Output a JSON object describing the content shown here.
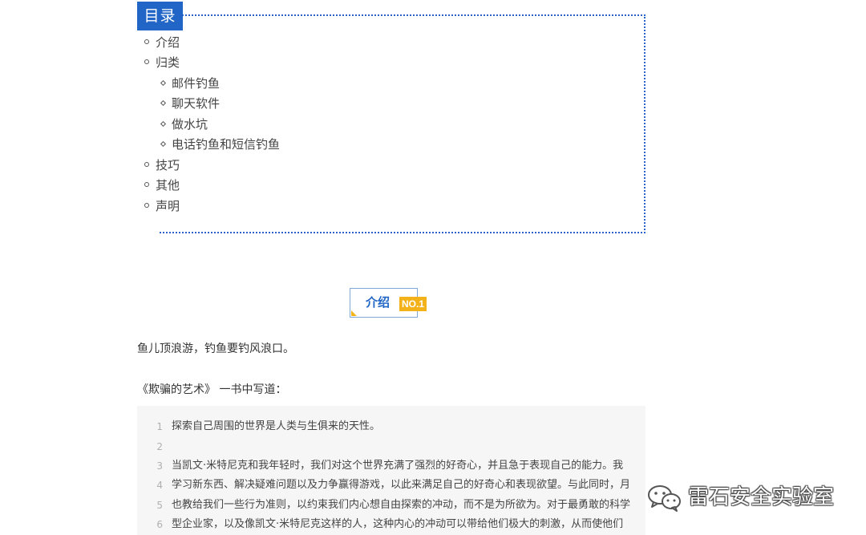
{
  "toc": {
    "title": "目录",
    "items": [
      {
        "label": "介绍",
        "level": 1
      },
      {
        "label": "归类",
        "level": 1
      },
      {
        "label": "邮件钓鱼",
        "level": 2
      },
      {
        "label": "聊天软件",
        "level": 2
      },
      {
        "label": "做水坑",
        "level": 2
      },
      {
        "label": "电话钓鱼和短信钓鱼",
        "level": 2
      },
      {
        "label": "技巧",
        "level": 1
      },
      {
        "label": "其他",
        "level": 1
      },
      {
        "label": "声明",
        "level": 1
      }
    ]
  },
  "section": {
    "label": "介绍",
    "badge": "NO.1"
  },
  "paragraphs": [
    "鱼儿顶浪游，钓鱼要钓风浪口。",
    "《欺骗的艺术》 一书中写道："
  ],
  "code": {
    "lines": [
      {
        "num": "1",
        "text": "探索自己周围的世界是人类与生俱来的天性。"
      },
      {
        "num": "2",
        "text": ""
      },
      {
        "num": "3",
        "text": "当凯文·米特尼克和我年轻时，我们对这个世界充满了强烈的好奇心，并且急于表现自己的能力。我"
      },
      {
        "num": "4",
        "text": "学习新东西、解决疑难问题以及力争赢得游戏，以此来满足自己的好奇心和表现欲望。与此同时，月"
      },
      {
        "num": "5",
        "text": "也教给我们一些行为准则，以约束我们内心想自由探索的冲动，而不是为所欲为。对于最勇敢的科学"
      },
      {
        "num": "6",
        "text": "型企业家，以及像凯文·米特尼克这样的人，这种内心的冲动可以带给他们极大的刺激，从而使他们"
      }
    ]
  },
  "watermark": {
    "text": "雷石安全实验室",
    "icon": "wechat-icon"
  }
}
